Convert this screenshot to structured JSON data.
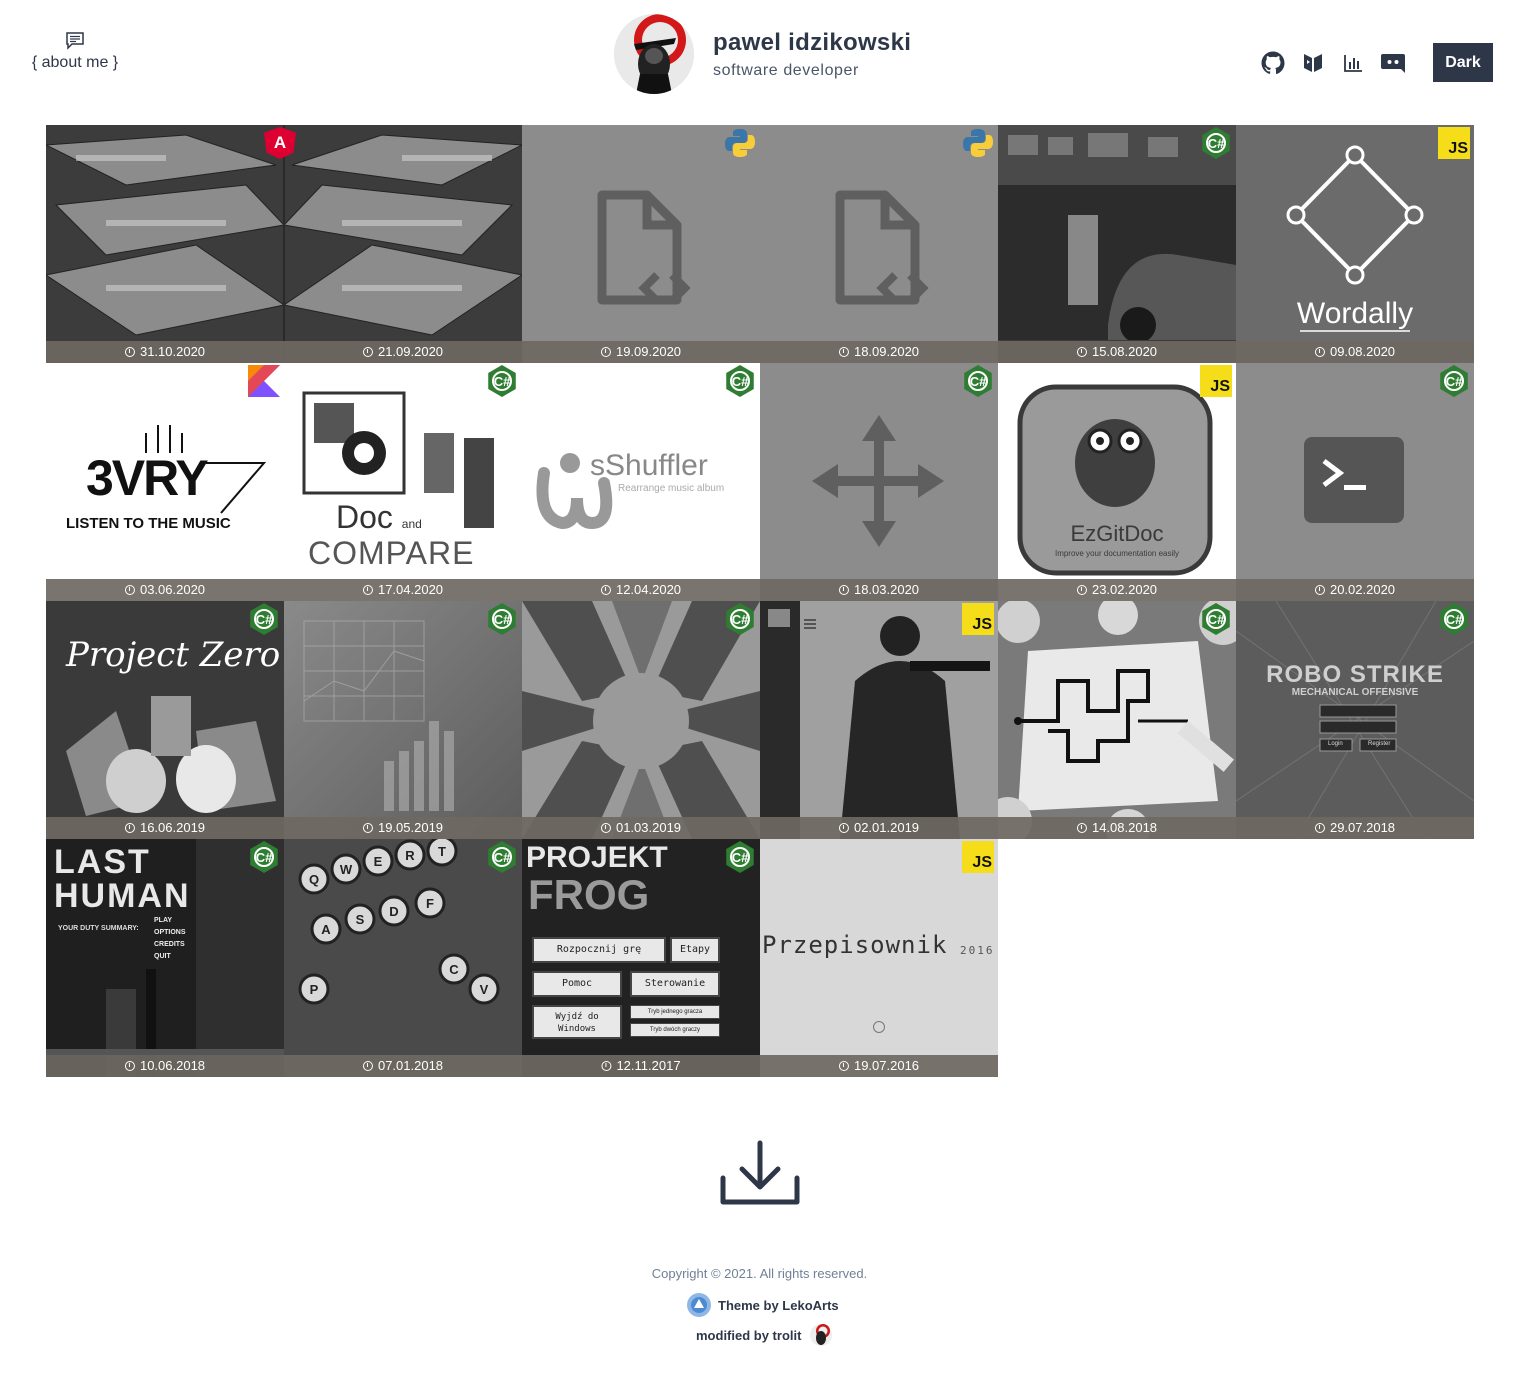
{
  "header": {
    "about_label": "{ about me }",
    "name": "pawel idzikowski",
    "subtitle": "software developer",
    "dark_label": "Dark",
    "socials": [
      "github-icon",
      "codewars-icon",
      "stats-icon",
      "discord-icon"
    ]
  },
  "tiles": [
    {
      "title": "",
      "dates": [
        "31.10.2020",
        "21.09.2020"
      ],
      "badge": "angular",
      "wide": true
    },
    {
      "title": "",
      "dates": [
        "19.09.2020"
      ],
      "badge": "python"
    },
    {
      "title": "",
      "dates": [
        "18.09.2020"
      ],
      "badge": "python"
    },
    {
      "title": "",
      "dates": [
        "15.08.2020"
      ],
      "badge": "csharp"
    },
    {
      "title": "Wordally",
      "dates": [
        "09.08.2020"
      ],
      "badge": "js"
    },
    {
      "title": "3VRY",
      "subtitle": "LISTEN TO THE MUSIC",
      "dates": [
        "03.06.2020"
      ],
      "badge": "kotlin"
    },
    {
      "title": "Doc and COMPARE",
      "dates": [
        "17.04.2020"
      ],
      "badge": "csharp"
    },
    {
      "title": "sShuffler",
      "subtitle": "Rearrange music album",
      "dates": [
        "12.04.2020"
      ],
      "badge": "csharp"
    },
    {
      "title": "",
      "dates": [
        "18.03.2020"
      ],
      "badge": "csharp"
    },
    {
      "title": "EzGitDoc",
      "subtitle": "Improve your documentation easily",
      "dates": [
        "23.02.2020"
      ],
      "badge": "js"
    },
    {
      "title": "",
      "dates": [
        "20.02.2020"
      ],
      "badge": "csharp"
    },
    {
      "title": "Project Zero",
      "dates": [
        "16.06.2019"
      ],
      "badge": "csharp"
    },
    {
      "title": "",
      "dates": [
        "19.05.2019"
      ],
      "badge": "csharp"
    },
    {
      "title": "",
      "dates": [
        "01.03.2019"
      ],
      "badge": "csharp"
    },
    {
      "title": "",
      "dates": [
        "02.01.2019"
      ],
      "badge": "js"
    },
    {
      "title": "",
      "dates": [
        "14.08.2018"
      ],
      "badge": "csharp"
    },
    {
      "title": "ROBO STRIKE",
      "subtitle": "MECHANICAL OFFENSIVE",
      "dates": [
        "29.07.2018"
      ],
      "badge": "csharp"
    },
    {
      "title": "LAST HUMAN",
      "dates": [
        "10.06.2018"
      ],
      "badge": "csharp"
    },
    {
      "title": "",
      "dates": [
        "07.01.2018"
      ],
      "badge": "csharp"
    },
    {
      "title": "PROJEKT FROG",
      "dates": [
        "12.11.2017"
      ],
      "badge": "csharp"
    },
    {
      "title": "Przepisownik",
      "subtitle": "2016",
      "dates": [
        "19.07.2016"
      ],
      "badge": "js"
    }
  ],
  "tile_text": {
    "wordally": "Wordally",
    "vry": "3VRY",
    "vry_sub": "LISTEN TO THE MUSIC",
    "doc": "Doc",
    "doc_and": "and",
    "compare": "COMPARE",
    "shuffler": "sShuffler",
    "shuffler_sub": "Rearrange music album",
    "ezgit": "EzGitDoc",
    "ezgit_sub": "Improve your documentation easily",
    "pzero": "Project Zero",
    "robo": "ROBO STRIKE",
    "robo_sub": "MECHANICAL OFFENSIVE",
    "robo_login": "Login",
    "robo_register": "Register",
    "last": "LAST",
    "human": "HUMAN",
    "lh_menu": [
      "PLAY",
      "OPTIONS",
      "CREDITS",
      "QUIT"
    ],
    "lh_summary": "YOUR DUTY SUMMARY:",
    "frog1": "PROJEKT",
    "frog2": "FROG",
    "frog_btns": [
      "Rozpocznij grę",
      "Etapy",
      "Pomoc",
      "Sterowanie",
      "Wyjdź do Windows",
      "Tryb jednego gracza",
      "Tryb dwóch graczy"
    ],
    "przep": "Przepisownik",
    "przep_year": "2016",
    "keys": [
      "Q",
      "W",
      "E",
      "R",
      "T",
      "A",
      "S",
      "D",
      "F",
      "V",
      "C",
      "P"
    ]
  },
  "footer": {
    "copyright": "Copyright © 2021. All rights reserved.",
    "theme": "Theme by LekoArts",
    "modified": "modified by trolit"
  }
}
